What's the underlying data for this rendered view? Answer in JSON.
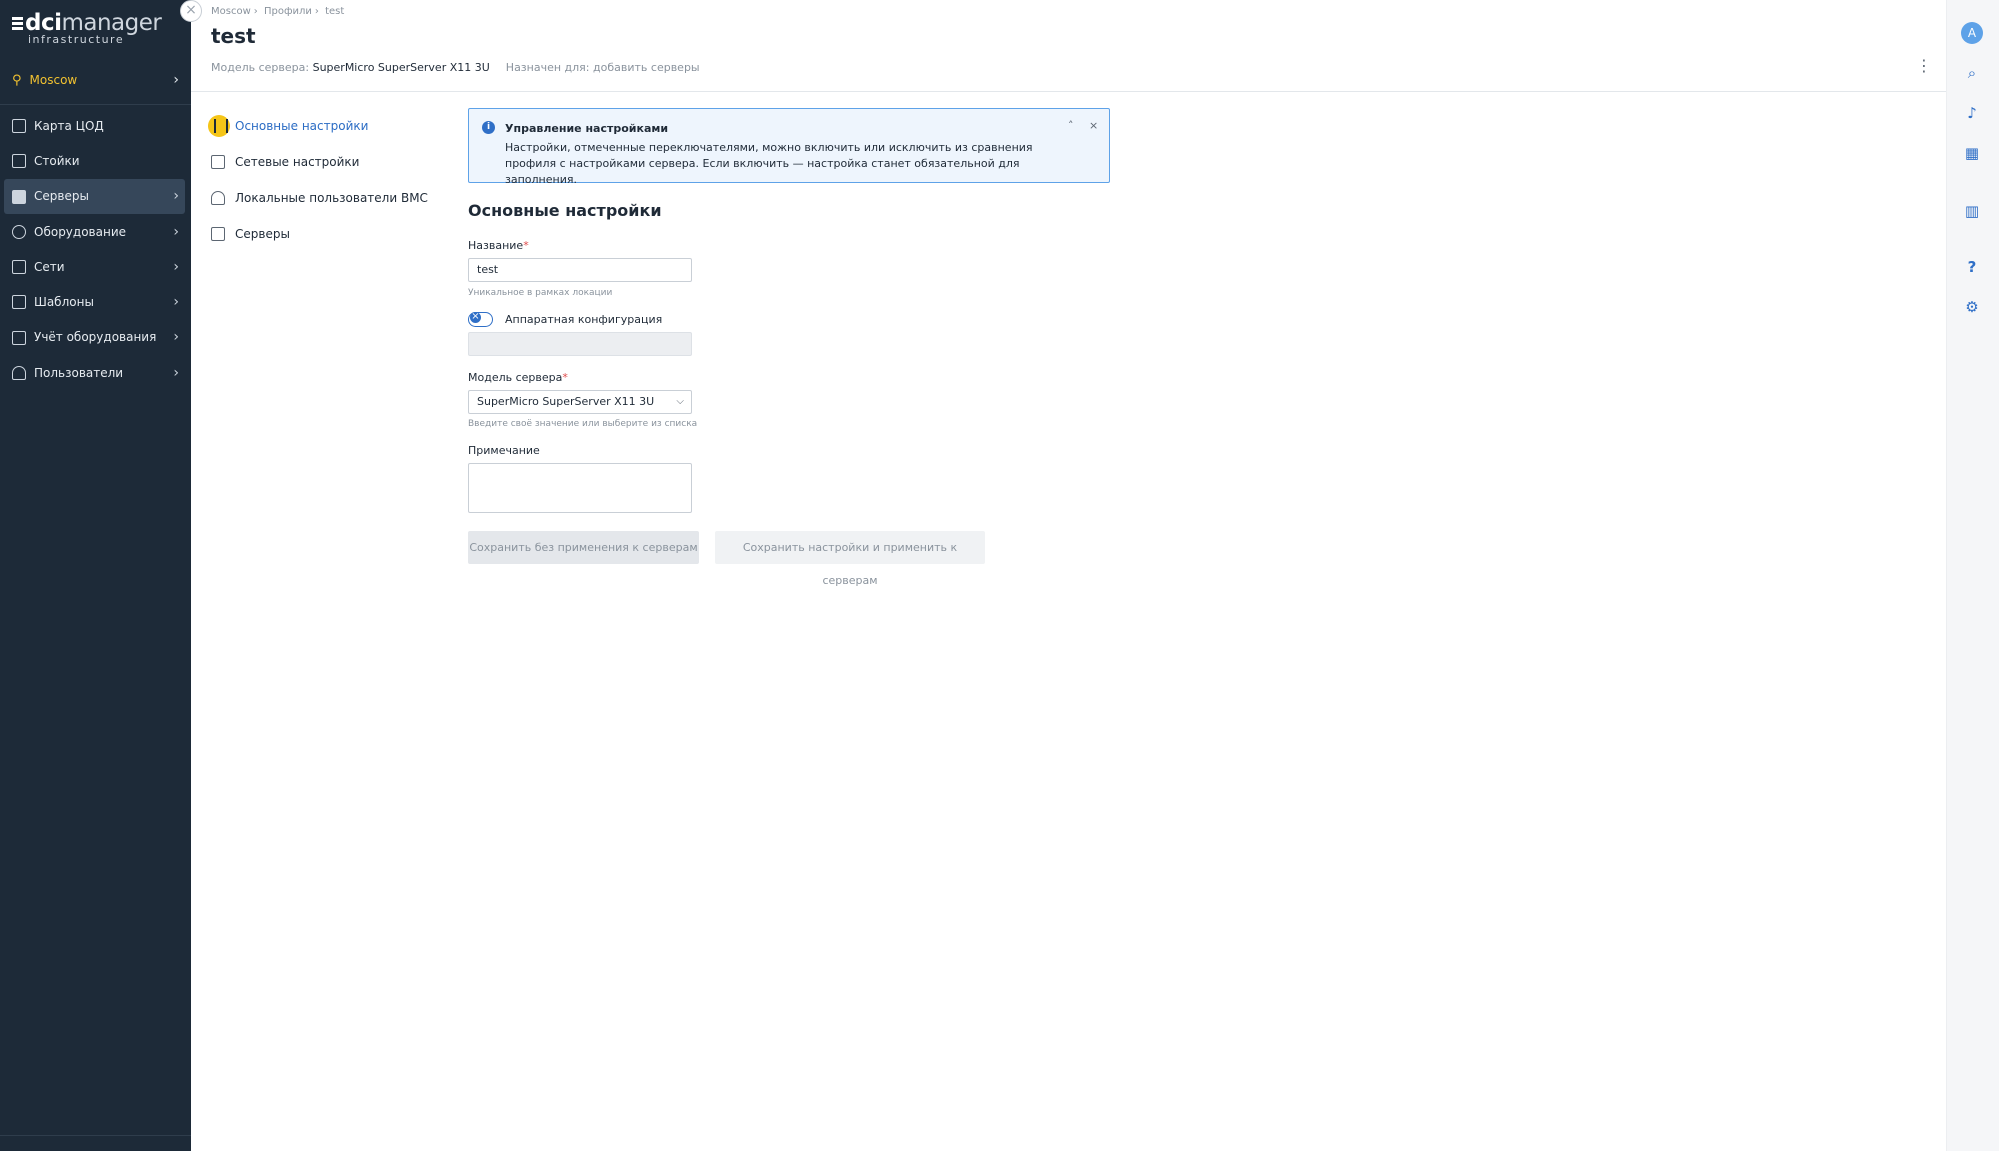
{
  "logo": {
    "brand_bold": "dci",
    "brand_rest": "manager",
    "subtitle": "infrastructure"
  },
  "location": {
    "label": "Moscow"
  },
  "sidebar": {
    "items": [
      {
        "label": "Карта ЦОД",
        "icon": "map-icon",
        "chevron": false
      },
      {
        "label": "Стойки",
        "icon": "rack-icon",
        "chevron": false
      },
      {
        "label": "Серверы",
        "icon": "server-icon",
        "chevron": true,
        "active": true
      },
      {
        "label": "Оборудование",
        "icon": "equipment-icon",
        "chevron": true
      },
      {
        "label": "Сети",
        "icon": "network-icon",
        "chevron": true
      },
      {
        "label": "Шаблоны",
        "icon": "template-icon",
        "chevron": true
      },
      {
        "label": "Учёт оборудования",
        "icon": "warehouse-icon",
        "chevron": true
      },
      {
        "label": "Пользователи",
        "icon": "user-icon",
        "chevron": true
      }
    ]
  },
  "breadcrumb": [
    "Moscow",
    "Профили",
    "test"
  ],
  "page": {
    "title": "test",
    "model_label": "Модель сервера:",
    "model_value": "SuperMicro SuperServer X11 3U",
    "assigned_label": "Назначен для:",
    "assigned_value": "добавить серверы"
  },
  "section_nav": [
    {
      "label": "Основные настройки",
      "icon": "settings-sliders-icon",
      "active": true
    },
    {
      "label": "Сетевые настройки",
      "icon": "network-settings-icon"
    },
    {
      "label": "Локальные пользователи BMC",
      "icon": "user-icon"
    },
    {
      "label": "Серверы",
      "icon": "server-icon"
    }
  ],
  "banner": {
    "title": "Управление настройками",
    "text": "Настройки, отмеченные переключателями, можно включить или исключить из сравнения профиля с настройками сервера. Если включить — настройка станет обязательной для заполнения."
  },
  "form": {
    "heading": "Основные настройки",
    "name_label": "Название",
    "name_value": "test",
    "name_hint": "Уникальное в рамках локации",
    "hw_toggle_label": "Аппаратная конфигурация",
    "model_label": "Модель сервера",
    "model_value": "SuperMicro SuperServer X11 3U",
    "model_hint": "Введите своё значение или выберите из списка",
    "note_label": "Примечание",
    "required_mark": "*"
  },
  "buttons": {
    "save_no_apply": "Сохранить без применения к серверам",
    "save_apply": "Сохранить настройки и применить к серверам"
  },
  "rail": {
    "avatar_letter": "A",
    "icons": [
      "search-icon",
      "bell-icon",
      "dashboard-icon",
      "chart-icon",
      "help-icon",
      "gear-icon"
    ]
  },
  "colors": {
    "accent": "#2f6fc7",
    "sidebar_bg": "#1d2a38",
    "location": "#f2c230",
    "banner_border": "#5ea2e8"
  }
}
